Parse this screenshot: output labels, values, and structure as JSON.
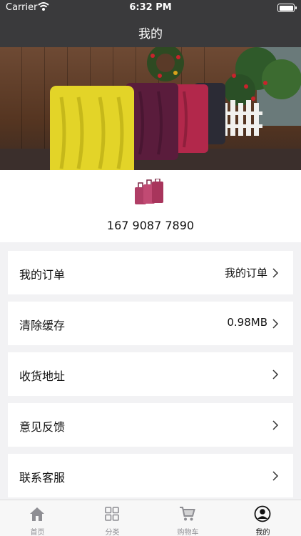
{
  "status_bar": {
    "carrier": "Carrier",
    "time": "6:32 PM"
  },
  "nav": {
    "title": "我的"
  },
  "profile": {
    "phone": "167 9087 7890"
  },
  "menu": [
    {
      "label": "我的订单",
      "value": "我的订单"
    },
    {
      "label": "清除缓存",
      "value": "0.98MB"
    },
    {
      "label": "收货地址",
      "value": ""
    },
    {
      "label": "意见反馈",
      "value": ""
    },
    {
      "label": "联系客服",
      "value": ""
    }
  ],
  "tabs": [
    {
      "label": "首页",
      "icon": "home-icon"
    },
    {
      "label": "分类",
      "icon": "grid-icon"
    },
    {
      "label": "购物车",
      "icon": "cart-icon"
    },
    {
      "label": "我的",
      "icon": "user-icon",
      "active": true
    }
  ],
  "colors": {
    "header": "#3a3a3c",
    "background": "#f2f2f4",
    "tab_inactive": "#8e8e93"
  }
}
